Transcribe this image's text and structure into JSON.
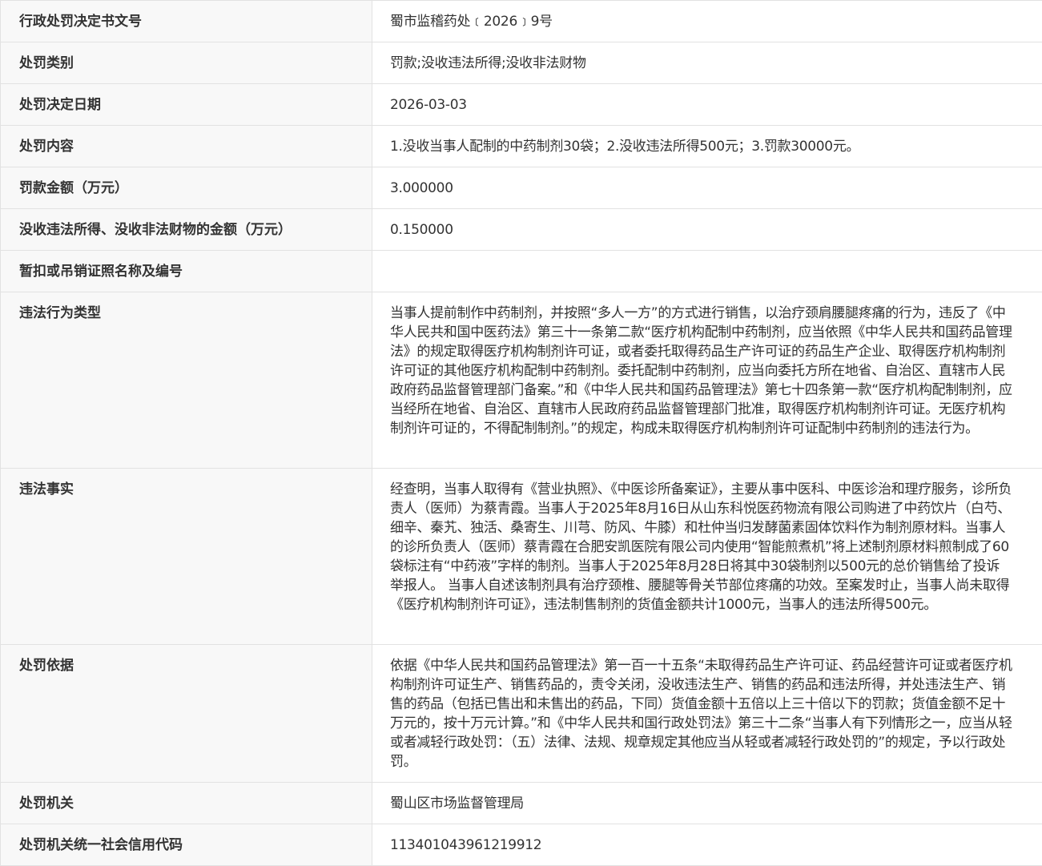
{
  "rows": [
    {
      "label": "行政处罚决定书文号",
      "value": "蜀市监稽药处﹝2026﹞9号"
    },
    {
      "label": "处罚类别",
      "value": "罚款;没收违法所得;没收非法财物"
    },
    {
      "label": "处罚决定日期",
      "value": "2026-03-03"
    },
    {
      "label": "处罚内容",
      "value": "1.没收当事人配制的中药制剂30袋；2.没收违法所得500元；3.罚款30000元。"
    },
    {
      "label": "罚款金额（万元）",
      "value": "3.000000"
    },
    {
      "label": "没收违法所得、没收非法财物的金额（万元）",
      "value": "0.150000"
    },
    {
      "label": "暂扣或吊销证照名称及编号",
      "value": ""
    },
    {
      "label": "违法行为类型",
      "value": "当事人提前制作中药制剂，并按照“多人一方”的方式进行销售，以治疗颈肩腰腿疼痛的行为，违反了《中华人民共和国中医药法》第三十一条第二款“医疗机构配制中药制剂，应当依照《中华人民共和国药品管理法》的规定取得医疗机构制剂许可证，或者委托取得药品生产许可证的药品生产企业、取得医疗机构制剂许可证的其他医疗机构配制中药制剂。委托配制中药制剂，应当向委托方所在地省、自治区、直辖市人民政府药品监督管理部门备案。”和《中华人民共和国药品管理法》第七十四条第一款“医疗机构配制制剂，应当经所在地省、自治区、直辖市人民政府药品监督管理部门批准，取得医疗机构制剂许可证。无医疗机构制剂许可证的，不得配制制剂。”的规定，构成未取得医疗机构制剂许可证配制中药制剂的违法行为。"
    },
    {
      "label": "违法事实",
      "value": "经查明，当事人取得有《营业执照》、《中医诊所备案证》，主要从事中医科、中医诊治和理疗服务，诊所负责人（医师）为蔡青霞。当事人于2025年8月16日从山东科悦医药物流有限公司购进了中药饮片（白芍、细辛、秦艽、独活、桑寄生、川芎、防风、牛膝）和杜仲当归发酵菌素固体饮料作为制剂原材料。当事人的诊所负责人（医师）蔡青霞在合肥安凯医院有限公司内使用“智能煎煮机”将上述制剂原材料煎制成了60袋标注有“中药液”字样的制剂。当事人于2025年8月28日将其中30袋制剂以500元的总价销售给了投诉举报人。 当事人自述该制剂具有治疗颈椎、腰腿等骨关节部位疼痛的功效。至案发时止，当事人尚未取得《医疗机构制剂许可证》，违法制售制剂的货值金额共计1000元，当事人的违法所得500元。"
    },
    {
      "label": "处罚依据",
      "value": "依据《中华人民共和国药品管理法》第一百一十五条“未取得药品生产许可证、药品经营许可证或者医疗机构制剂许可证生产、销售药品的，责令关闭，没收违法生产、销售的药品和违法所得，并处违法生产、销售的药品（包括已售出和未售出的药品，下同）货值金额十五倍以上三十倍以下的罚款；货值金额不足十万元的，按十万元计算。”和《中华人民共和国行政处罚法》第三十二条“当事人有下列情形之一，应当从轻或者减轻行政处罚：（五）法律、法规、规章规定其他应当从轻或者减轻行政处罚的”的规定，予以行政处罚。"
    },
    {
      "label": "处罚机关",
      "value": "蜀山区市场监督管理局"
    },
    {
      "label": "处罚机关统一社会信用代码",
      "value": "113401043961219912"
    }
  ]
}
